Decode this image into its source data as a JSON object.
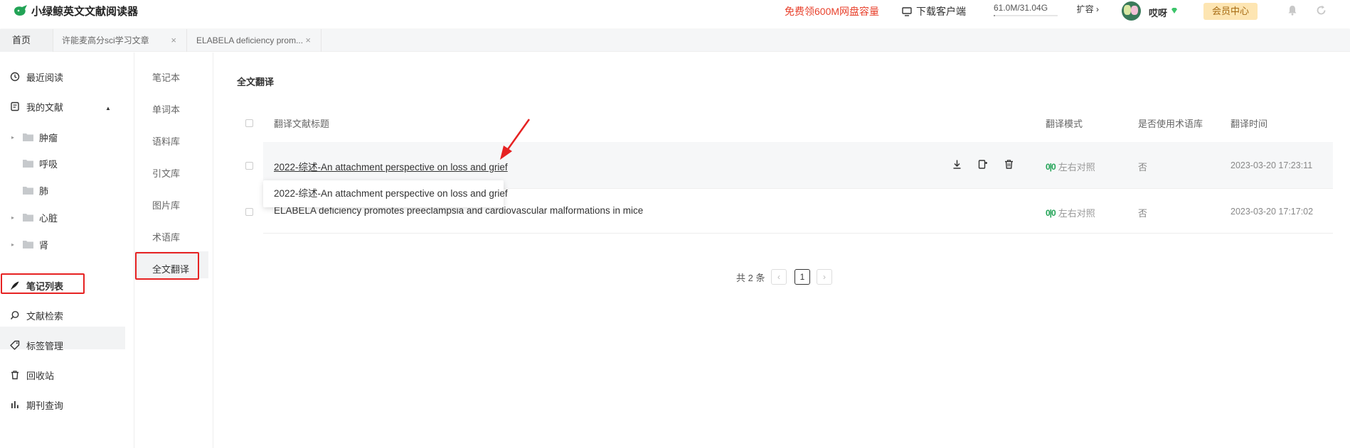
{
  "header": {
    "app_title": "小绿鲸英文文献阅读器",
    "promo": "免费领600M网盘容量",
    "download_label": "下载客户端",
    "storage_text": "61.0M/31.04G",
    "storage_used_fraction": 0.002,
    "expand_label": "扩容 ›",
    "username": "哎呀",
    "member_label": "会员中心",
    "colors": {
      "promo": "#e8412c",
      "member_bg": "#fde5b2",
      "member_text": "#a66a12",
      "accent": "#22a356"
    }
  },
  "tabs": [
    {
      "label": "首页"
    },
    {
      "label": "许能麦高分sci学习文章",
      "close": "×"
    },
    {
      "label": "ELABELA deficiency prom...",
      "close": "×"
    }
  ],
  "sidebar": {
    "items": [
      {
        "label": "最近阅读",
        "icon": "clock-icon"
      },
      {
        "label": "我的文献",
        "icon": "document-icon",
        "caret": "▲"
      },
      {
        "label": "笔记列表",
        "icon": "pen-icon"
      },
      {
        "label": "文献检索",
        "icon": "search-icon"
      },
      {
        "label": "标签管理",
        "icon": "tag-icon"
      },
      {
        "label": "回收站",
        "icon": "trash-icon"
      },
      {
        "label": "期刊查询",
        "icon": "bar-chart-icon"
      }
    ],
    "folders": [
      {
        "label": "肿瘤",
        "arrow": "▸"
      },
      {
        "label": "呼吸",
        "arrow": ""
      },
      {
        "label": "肺",
        "arrow": ""
      },
      {
        "label": "心脏",
        "arrow": "▸"
      },
      {
        "label": "肾",
        "arrow": "▸"
      }
    ]
  },
  "subsidebar": {
    "items": [
      "笔记本",
      "单词本",
      "语料库",
      "引文库",
      "图片库",
      "术语库",
      "全文翻译"
    ],
    "active": "全文翻译"
  },
  "main": {
    "title": "全文翻译",
    "columns": {
      "title": "翻译文献标题",
      "mode": "翻译模式",
      "glossary": "是否使用术语库",
      "time": "翻译时间"
    },
    "rows": [
      {
        "title": "2022-综述-An attachment perspective on loss and grief",
        "mode_icon": "0|0",
        "mode": "左右对照",
        "glossary": "否",
        "time": "2023-03-20 17:23:11"
      },
      {
        "title": "ELABELA deficiency promotes preeclampsia and cardiovascular malformations in mice",
        "mode_icon": "0|0",
        "mode": "左右对照",
        "glossary": "否",
        "time": "2023-03-20 17:17:02"
      }
    ],
    "tooltip": "2022-综述-An attachment perspective on loss and grief",
    "row_actions": [
      "download-icon",
      "copy-icon",
      "delete-icon"
    ]
  },
  "pagination": {
    "total": "共 2 条",
    "prev": "‹",
    "current": "1",
    "next": "›"
  }
}
